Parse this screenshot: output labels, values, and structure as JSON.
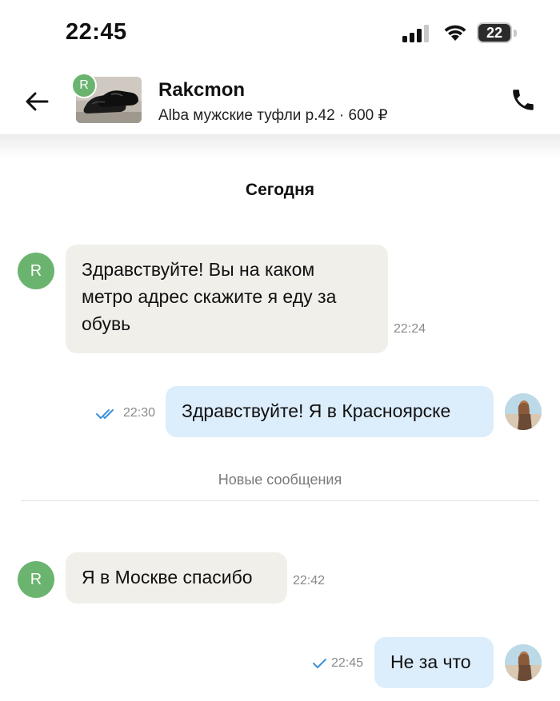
{
  "status_bar": {
    "time": "22:45",
    "battery": "22"
  },
  "header": {
    "seller_name": "Rakcmon",
    "seller_initial": "R",
    "item_info": "Alba мужские туфли р.42 · 600 ₽",
    "back_icon": "arrow-left-icon",
    "call_icon": "phone-icon"
  },
  "chat": {
    "date_divider": "Сегодня",
    "new_messages_divider": "Новые сообщения",
    "messages": [
      {
        "direction": "in",
        "text": "Здравствуйте! Вы на каком метро адрес скажите я еду за обувь",
        "time": "22:24",
        "avatar_initial": "R"
      },
      {
        "direction": "out",
        "text": "Здравствуйте! Я в Красноярске",
        "time": "22:30",
        "status": "read"
      },
      {
        "direction": "in",
        "text": "Я в Москве спасибо",
        "time": "22:42",
        "avatar_initial": "R"
      },
      {
        "direction": "out",
        "text": "Не за что",
        "time": "22:45",
        "status": "delivered"
      }
    ]
  },
  "colors": {
    "incoming_bubble": "#f1efea",
    "outgoing_bubble": "#dcedfb",
    "avatar_green": "#6bb46f",
    "check_blue": "#3a8fd9"
  }
}
